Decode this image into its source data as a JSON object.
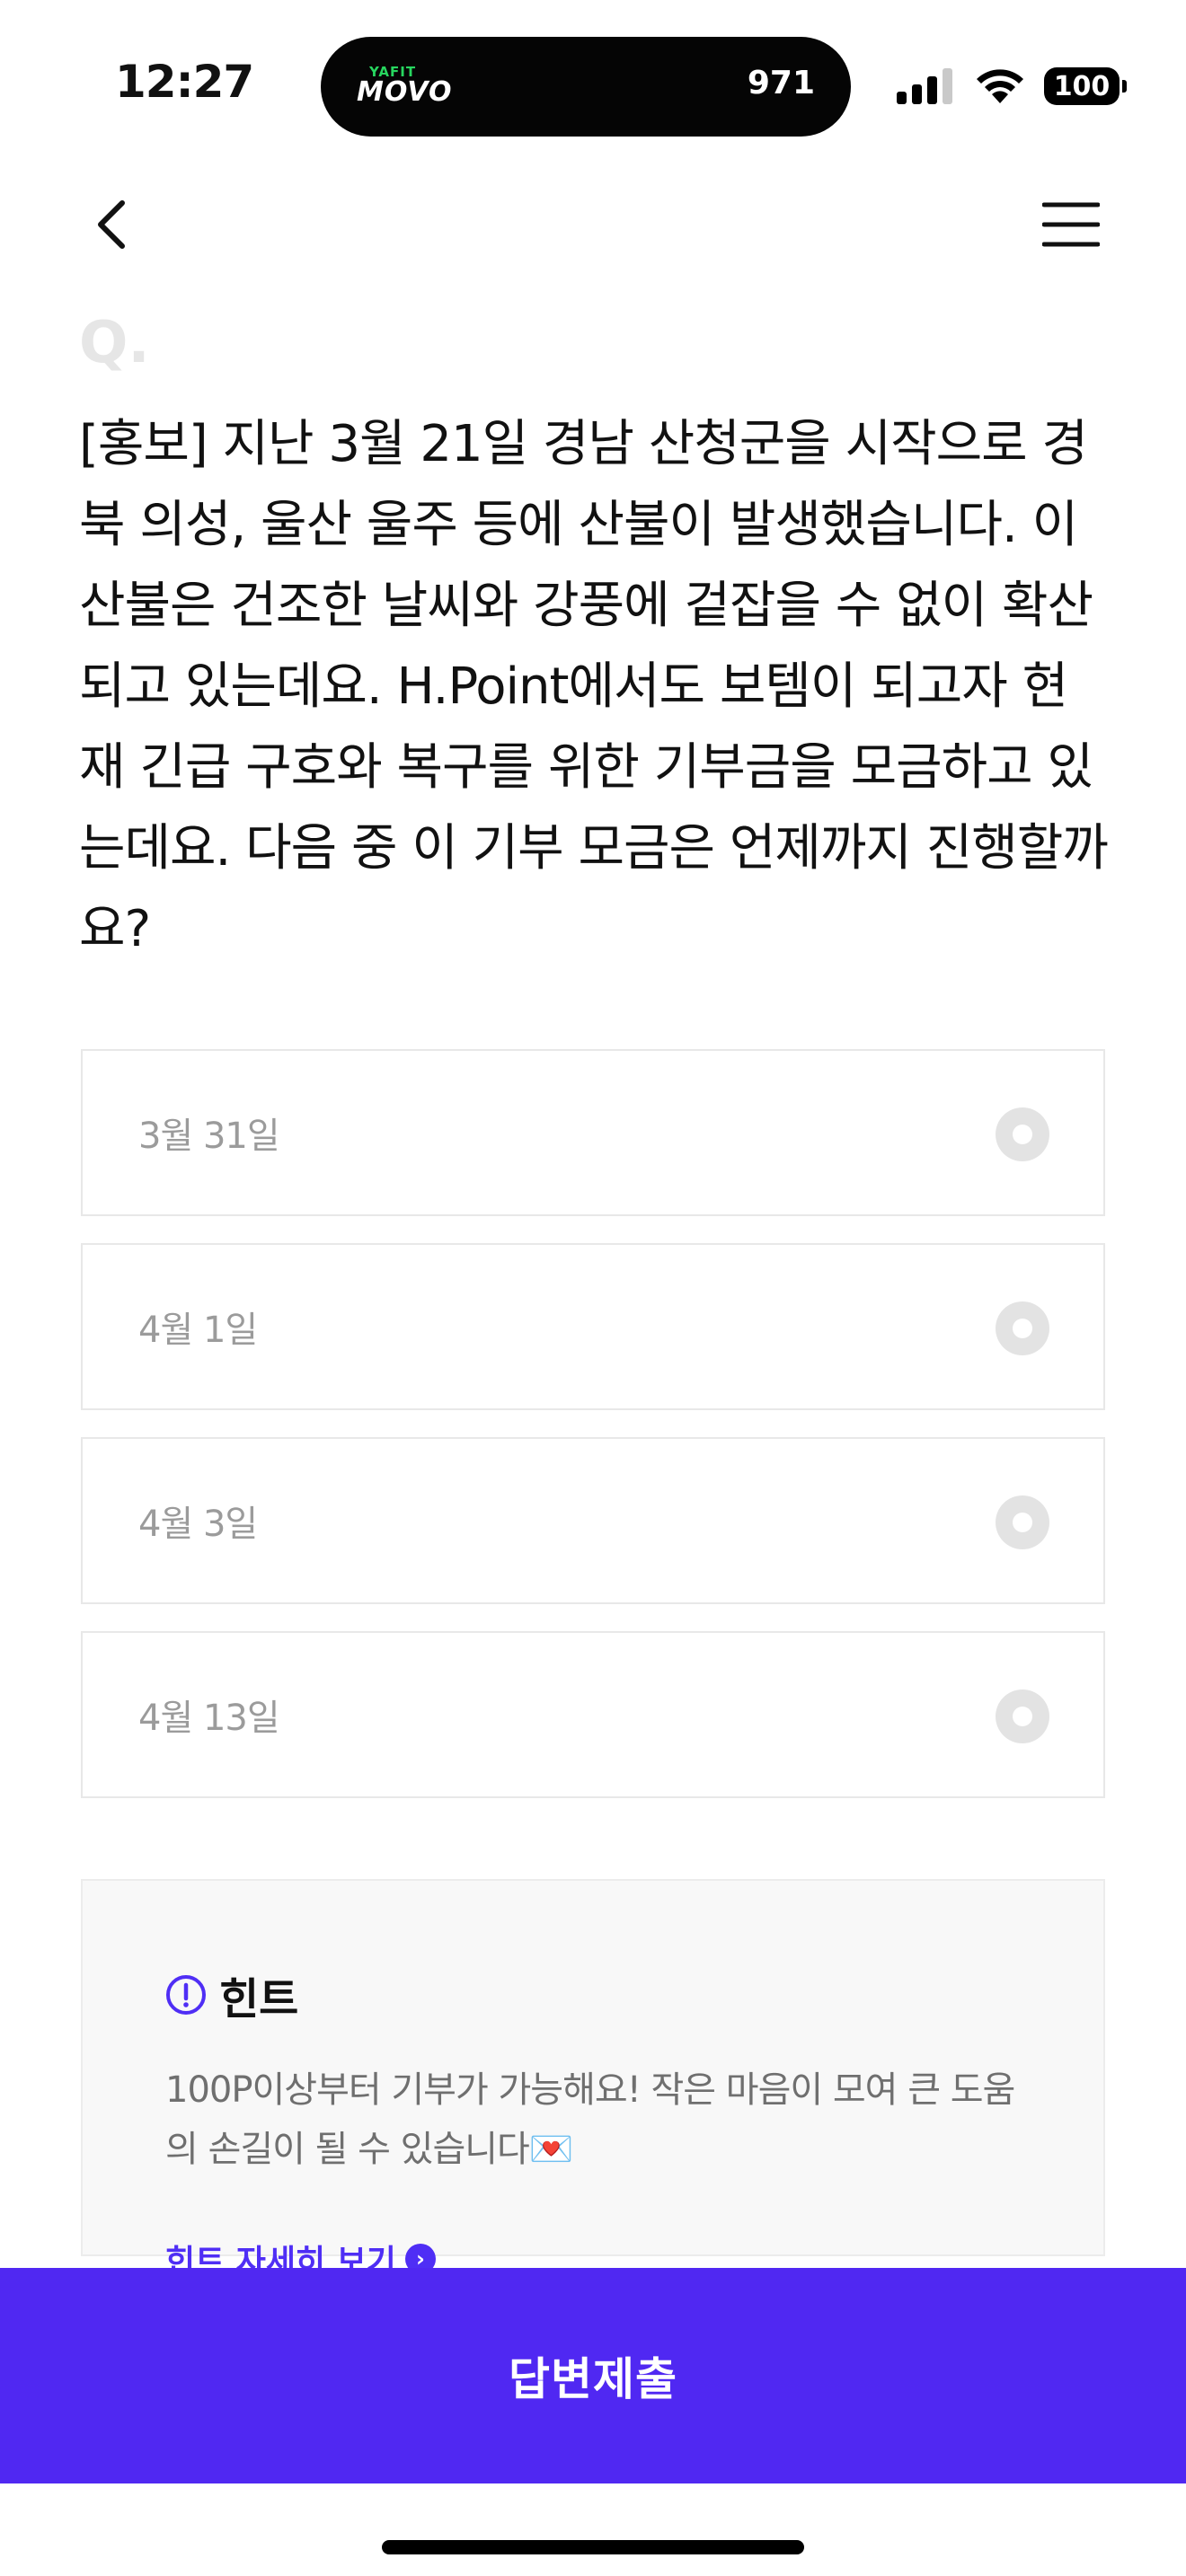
{
  "status_bar": {
    "time": "12:27",
    "island_brand_top": "YAFIT",
    "island_brand_main": "MOVO",
    "island_count": "971",
    "battery": "100"
  },
  "question": {
    "marker": "Q.",
    "text": "[홍보] 지난 3월 21일 경남 산청군을 시작으로 경북 의성, 울산 울주 등에 산불이 발생했습니다. 이 산불은 건조한 날씨와 강풍에 겉잡을 수 없이 확산되고 있는데요. H.Point에서도 보템이 되고자 현재 긴급 구호와 복구를 위한 기부금을 모금하고 있는데요. 다음 중 이 기부 모금은 언제까지 진행할까요?"
  },
  "options": [
    {
      "label": "3월 31일"
    },
    {
      "label": "4월 1일"
    },
    {
      "label": "4월 3일"
    },
    {
      "label": "4월 13일"
    }
  ],
  "hint": {
    "title": "힌트",
    "body": "100P이상부터 기부가 가능해요! 작은 마음이 모여 큰 도움의 손길이 될 수 있습니다💌",
    "link": "힌트 자세히 보기"
  },
  "submit_label": "답변제출",
  "colors": {
    "accent": "#5028f2",
    "hint_link": "#4f2ef5",
    "option_text": "#9b9b9b",
    "marker": "#e6e6e6"
  },
  "icons": [
    "back-arrow-icon",
    "hamburger-menu-icon",
    "radio-icon",
    "info-icon",
    "chevron-right-icon",
    "signal-icon",
    "wifi-icon",
    "battery-icon"
  ]
}
